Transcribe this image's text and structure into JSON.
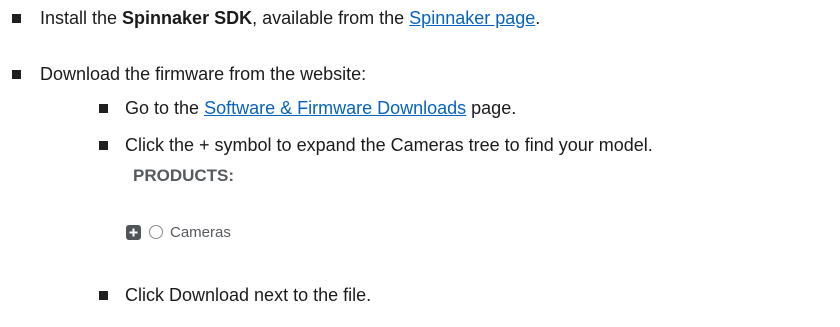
{
  "items": [
    {
      "pre": "Install the ",
      "bold": "Spinnaker SDK",
      "mid": ", available from the ",
      "link": "Spinnaker page",
      "post": "."
    },
    {
      "text": "Download the firmware from the website:"
    }
  ],
  "subitems": [
    {
      "pre": "Go to the ",
      "link": "Software & Firmware Downloads",
      "post": " page."
    },
    {
      "text": "Click the + symbol to expand the Cameras tree to find your model."
    },
    {
      "text": "Click Download next to the file."
    }
  ],
  "products": {
    "heading": "PRODUCTS:",
    "tree_label": "Cameras",
    "expand_symbol": "+"
  },
  "colors": {
    "link": "#0563c1",
    "bullet": "#1f1f1f",
    "products_text": "#555a5f"
  }
}
